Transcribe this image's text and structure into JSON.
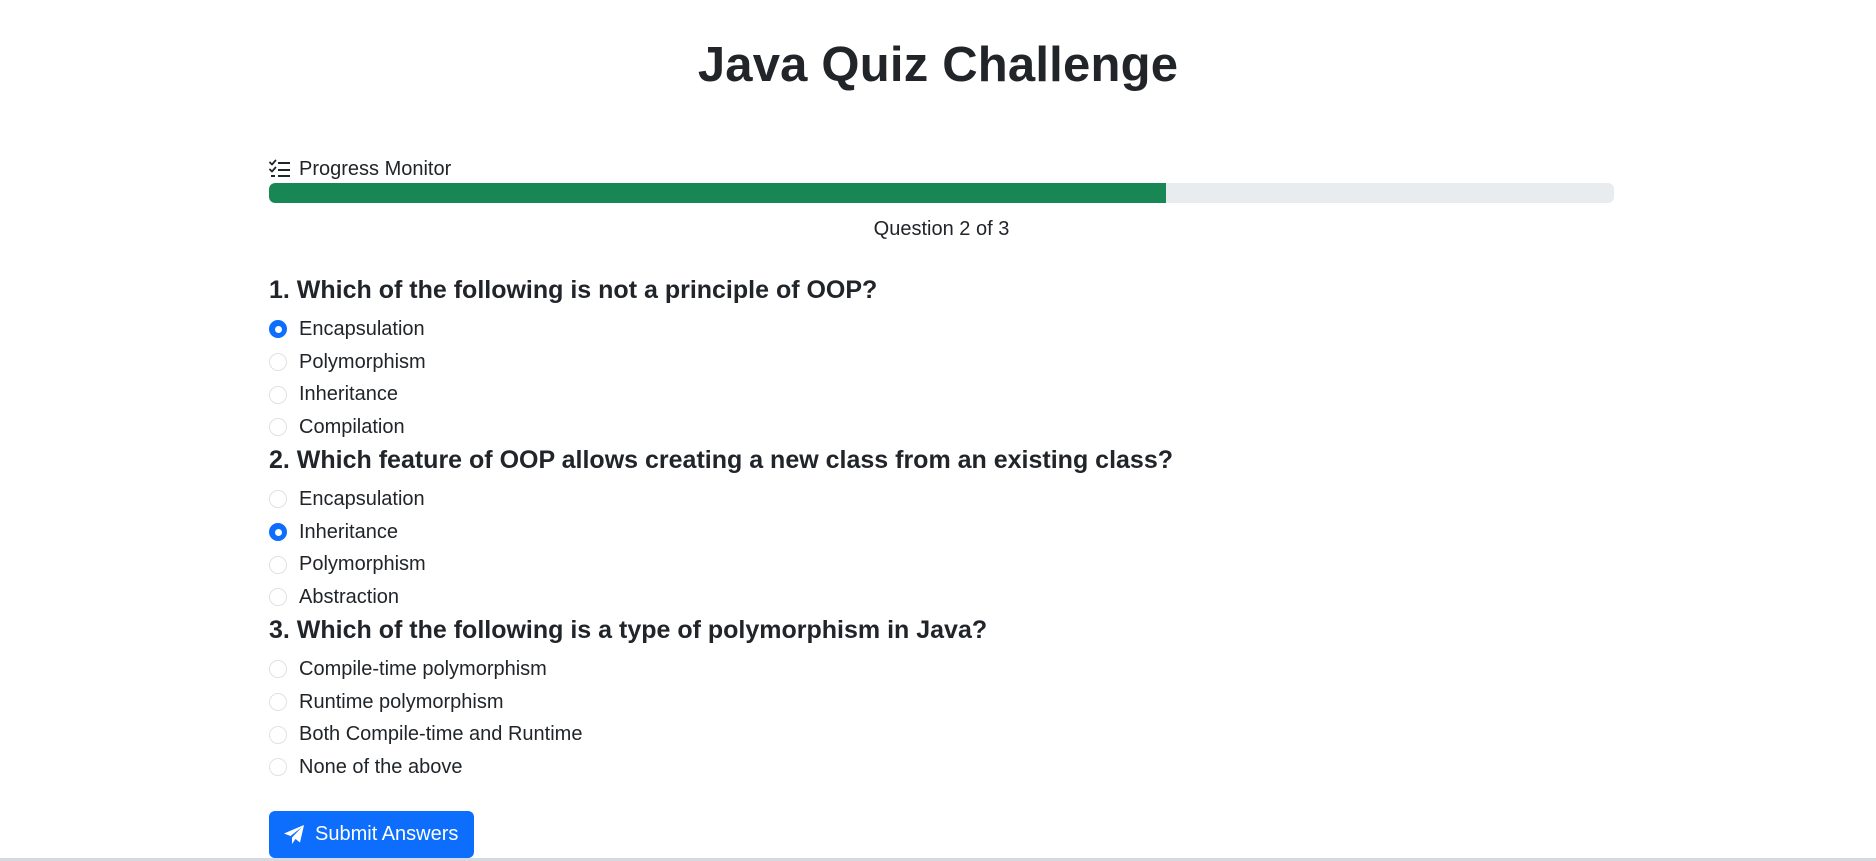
{
  "page": {
    "title": "Java Quiz Challenge"
  },
  "progress": {
    "label": "Progress Monitor",
    "icon": "list-check-icon",
    "fraction": 0.667,
    "text": "Question 2 of 3",
    "fill_color": "#198754",
    "track_color": "#e9ecef"
  },
  "questions": [
    {
      "text": "1. Which of the following is not a principle of OOP?",
      "options": [
        "Encapsulation",
        "Polymorphism",
        "Inheritance",
        "Compilation"
      ],
      "selected": 0
    },
    {
      "text": "2. Which feature of OOP allows creating a new class from an existing class?",
      "options": [
        "Encapsulation",
        "Inheritance",
        "Polymorphism",
        "Abstraction"
      ],
      "selected": 1
    },
    {
      "text": "3. Which of the following is a type of polymorphism in Java?",
      "options": [
        "Compile-time polymorphism",
        "Runtime polymorphism",
        "Both Compile-time and Runtime",
        "None of the above"
      ],
      "selected": null
    }
  ],
  "submit": {
    "label": "Submit Answers",
    "icon": "paper-plane-icon",
    "color": "#0d6efd"
  }
}
